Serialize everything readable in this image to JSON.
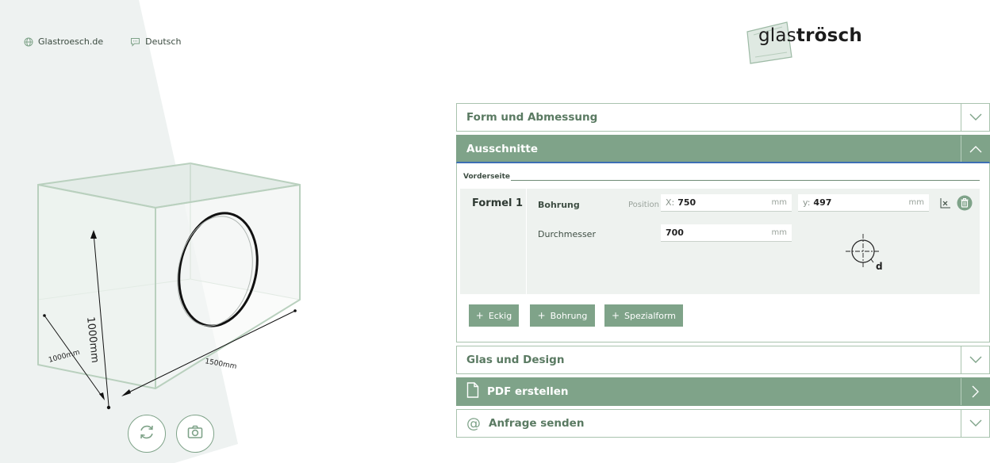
{
  "toplinks": {
    "site": "Glastroesch.de",
    "language": "Deutsch"
  },
  "logo": {
    "light": "glas",
    "bold": "trösch"
  },
  "dimensions": {
    "height": "1000mm",
    "depth": "1000mm",
    "width": "1500mm"
  },
  "accordion": {
    "form": "Form und Abmessung",
    "cutouts": "Ausschnitte",
    "glass": "Glas und Design",
    "pdf": "PDF erstellen",
    "request": "Anfrage senden"
  },
  "cutouts": {
    "section_title": "Vorderseite",
    "formula_name": "Formel 1",
    "type": "Bohrung",
    "position_label": "Position",
    "x_prefix": "X:",
    "x_value": "750",
    "x_unit": "mm",
    "y_prefix": "y:",
    "y_value": "497",
    "y_unit": "mm",
    "diameter_label": "Durchmesser",
    "diameter_value": "700",
    "diameter_unit": "mm",
    "diagram_label": "d"
  },
  "add_buttons": {
    "square": "Eckig",
    "drill": "Bohrung",
    "special": "Spezialform"
  },
  "colors": {
    "accent": "#7fa389",
    "active_border": "#3d6fb4"
  }
}
